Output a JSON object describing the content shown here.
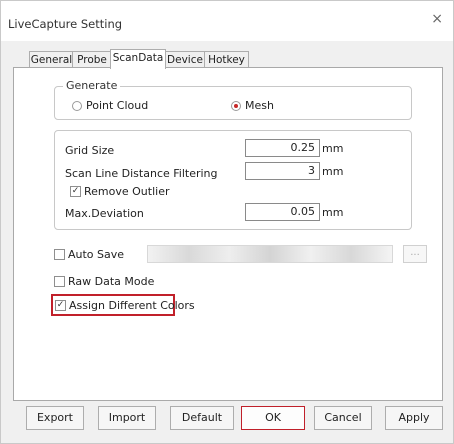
{
  "window": {
    "title": "LiveCapture Setting",
    "close_glyph": "×"
  },
  "tabs": [
    "General",
    "Probe",
    "ScanData",
    "Device",
    "Hotkey"
  ],
  "generate": {
    "legend": "Generate",
    "options": [
      {
        "label": "Point Cloud",
        "selected": false
      },
      {
        "label": "Mesh",
        "selected": true
      }
    ]
  },
  "params": {
    "grid_size": {
      "label": "Grid Size",
      "value": "0.25",
      "unit": "mm"
    },
    "scan_line": {
      "label": "Scan Line Distance Filtering",
      "value": "3",
      "unit": "mm"
    },
    "remove_outlier": {
      "label": "Remove Outlier",
      "checked": true
    },
    "max_deviation": {
      "label": "Max.Deviation",
      "value": "0.05",
      "unit": "mm"
    }
  },
  "options": {
    "auto_save": {
      "label": "Auto Save",
      "checked": false,
      "browse_label": "..."
    },
    "raw_data": {
      "label": "Raw Data Mode",
      "checked": false
    },
    "assign_colors": {
      "label": "Assign Different Colors",
      "checked": true
    }
  },
  "buttons": {
    "export": "Export",
    "import": "Import",
    "default": "Default",
    "ok": "OK",
    "cancel": "Cancel",
    "apply": "Apply"
  },
  "colors": {
    "highlight": "#c1202a",
    "radio_dot": "#c62828"
  }
}
